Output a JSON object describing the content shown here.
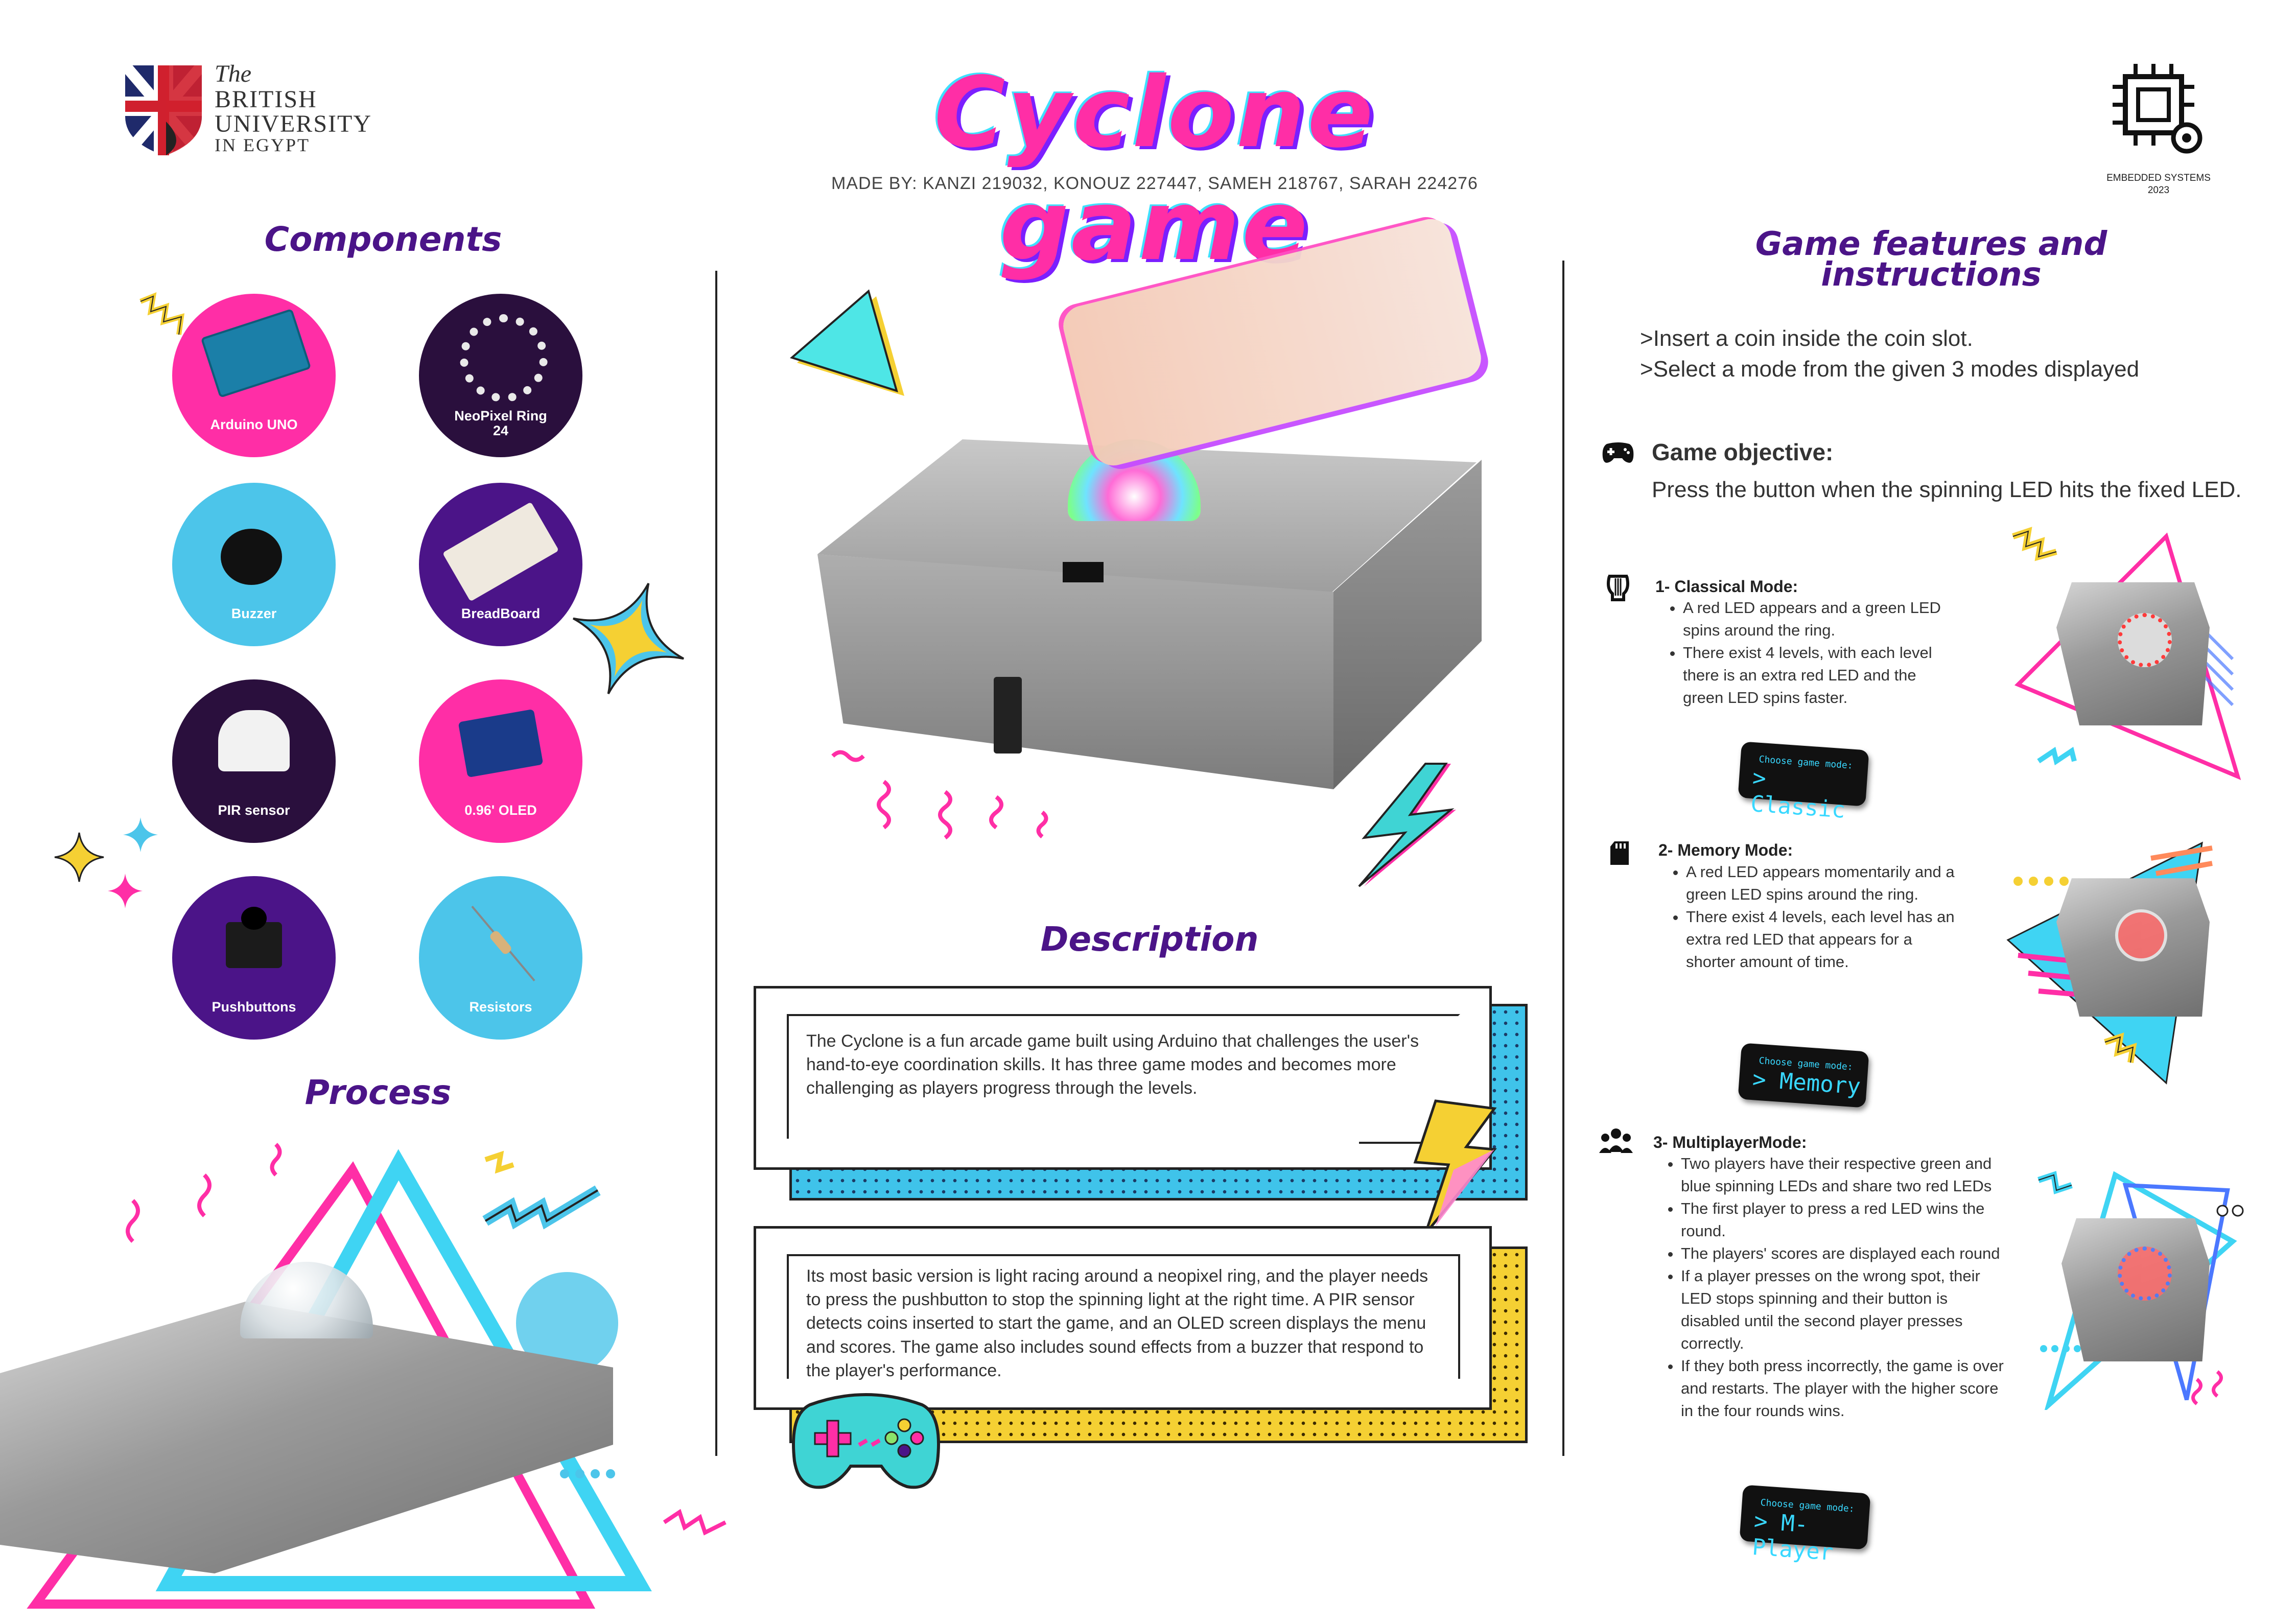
{
  "header": {
    "logo": {
      "line1": "The",
      "line2": "BRITISH",
      "line3": "UNIVERSITY",
      "line4": "IN EGYPT"
    },
    "title": "Cyclone game",
    "made_by": "MADE BY: KANZI 219032, KONOUZ 227447, SAMEH 218767, SARAH 224276",
    "badge": {
      "line1": "EMBEDDED SYSTEMS",
      "line2": "2023"
    }
  },
  "components": {
    "title": "Components",
    "items": [
      {
        "label": "Arduino UNO",
        "color": "#ff2ea6"
      },
      {
        "label": "NeoPixel Ring 24",
        "color": "#2a0f3d"
      },
      {
        "label": "Buzzer",
        "color": "#4cc5ea"
      },
      {
        "label": "BreadBoard",
        "color": "#4b1488"
      },
      {
        "label": "PIR sensor",
        "color": "#2a0f3d"
      },
      {
        "label": "0.96' OLED",
        "color": "#ff2ea6"
      },
      {
        "label": "Pushbuttons",
        "color": "#4b1488"
      },
      {
        "label": "Resistors",
        "color": "#4cc5ea"
      }
    ]
  },
  "process": {
    "title": "Process"
  },
  "description": {
    "title": "Description",
    "paragraph1": "The Cyclone is a fun arcade game built using Arduino that challenges the user's hand-to-eye coordination skills. It has three game modes and becomes more challenging as players progress through the levels.",
    "paragraph2": " Its most basic version is light racing around a neopixel ring, and the player needs to press the pushbutton to stop the spinning light at the right time. A PIR sensor detects coins inserted to start the game, and an OLED screen displays the menu and scores. The game also includes sound effects from a buzzer that respond to the player's performance."
  },
  "features": {
    "title_line1": "Game features and",
    "title_line2": "instructions",
    "instructions": [
      ">Insert a coin inside the coin slot.",
      ">Select a mode from the given 3 modes displayed"
    ],
    "objective_title": "Game objective:",
    "objective_text": "Press the button when the spinning LED hits the fixed LED.",
    "modes": [
      {
        "title": "1- Classical Mode:",
        "bullets": [
          "A red LED appears and a green LED spins around the ring.",
          "There exist 4 levels, with each level there is an extra red LED and the green LED spins faster."
        ],
        "oled_small": "Choose game mode:",
        "oled_big": "> Classic"
      },
      {
        "title": "2- Memory Mode:",
        "bullets": [
          "A red LED appears momentarily and a green LED spins around the ring.",
          "There exist 4 levels, each level has an extra red LED that appears for a shorter amount of time."
        ],
        "oled_small": "Choose game mode:",
        "oled_big": "> Memory"
      },
      {
        "title": "3- MultiplayerMode:",
        "bullets": [
          "Two players have their respective green and blue spinning LEDs and share two red LEDs",
          "The first player to press a red LED wins the round.",
          "The players' scores are displayed each round",
          "If a player presses on the wrong spot, their LED stops spinning and their button is disabled until the second player presses correctly.",
          " If they both press incorrectly, the game is over and restarts. The player with the higher score in the four rounds wins."
        ],
        "oled_small": "Choose game mode:",
        "oled_big": "> M-Player"
      }
    ]
  },
  "colors": {
    "pink": "#ff2ea6",
    "purple": "#4b1488",
    "cyan": "#4cc5ea",
    "yellow": "#f5d033",
    "dark": "#2a0f3d"
  }
}
